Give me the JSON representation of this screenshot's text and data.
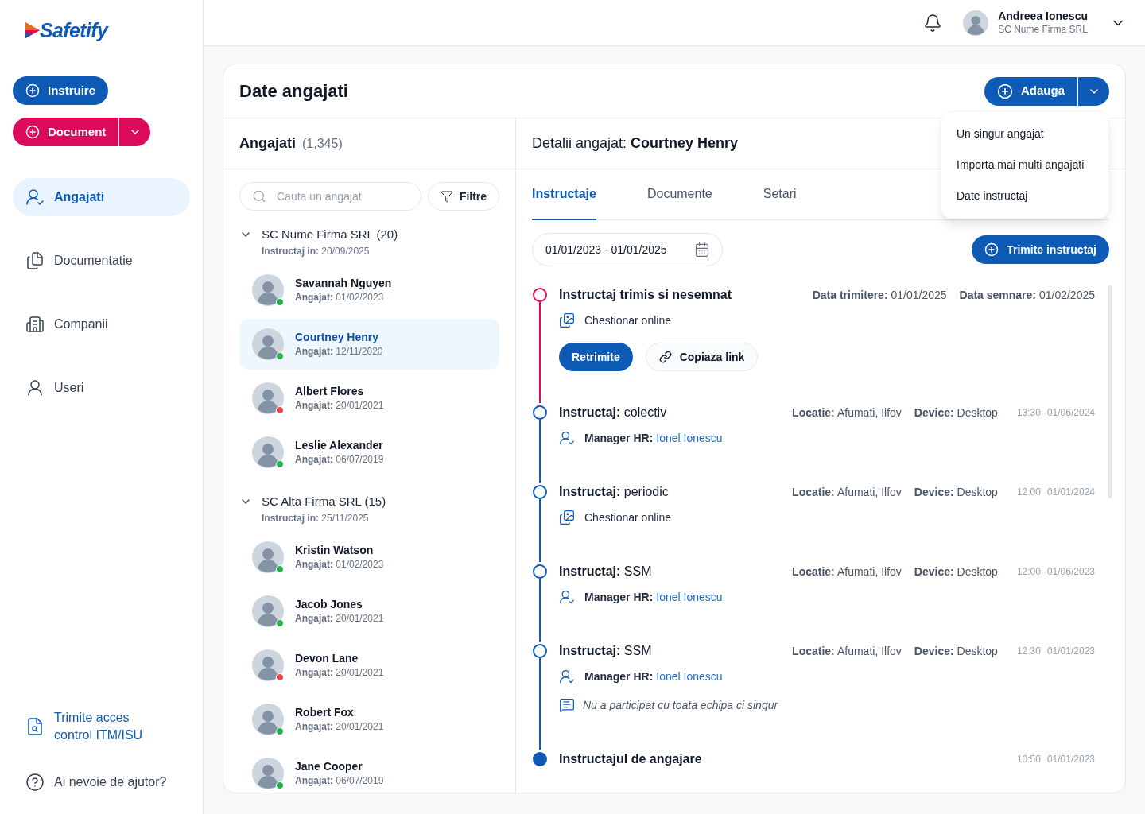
{
  "brand": {
    "name": "Safetify"
  },
  "sidebar": {
    "actions": [
      {
        "label": "Instruire",
        "kind": "primary",
        "has_menu": false
      },
      {
        "label": "Document",
        "kind": "accent",
        "has_menu": true
      }
    ],
    "nav": [
      {
        "label": "Angajati",
        "selected": true
      },
      {
        "label": "Documentatie",
        "selected": false
      },
      {
        "label": "Companii",
        "selected": false
      },
      {
        "label": "Useri",
        "selected": false
      }
    ],
    "footer": [
      {
        "label": "Trimite acces control ITM/ISU",
        "kind": "link"
      },
      {
        "label": "Ai nevoie de ajutor?",
        "kind": "help"
      }
    ]
  },
  "header": {
    "user": {
      "name": "Andreea Ionescu",
      "company": "SC Nume Firma SRL"
    }
  },
  "page": {
    "title": "Date angajati",
    "add_button": {
      "label": "Adauga"
    },
    "add_menu": {
      "open": true,
      "items": [
        "Un singur angajat",
        "Importa mai multi angajati",
        "Date instructaj"
      ]
    }
  },
  "employees": {
    "title": "Angajati",
    "count": "(1,345)",
    "search": {
      "placeholder": "Cauta un angajat"
    },
    "filter_button": "Filtre",
    "groups": [
      {
        "name": "SC Nume Firma SRL (20)",
        "subtitle": "**Instructaj in:** 20/09/2025",
        "expanded": true,
        "employees": [
          {
            "name": "Savannah Nguyen",
            "hired": "**Angajat:** 01/02/2023",
            "selected": false,
            "color": "#22b14c"
          },
          {
            "name": "Courtney Henry",
            "hired": "**Angajat:** 12/11/2020",
            "selected": true,
            "color": "#22b14c"
          },
          {
            "name": "Albert Flores",
            "hired": "**Angajat:** 20/01/2021",
            "selected": false,
            "color": "#e5484d"
          },
          {
            "name": "Leslie Alexander",
            "hired": "**Angajat:** 06/07/2019",
            "selected": false,
            "color": "#22b14c"
          }
        ]
      },
      {
        "name": "SC Alta Firma SRL (15)",
        "subtitle": "**Instructaj in:** 25/11/2025",
        "expanded": true,
        "employees": [
          {
            "name": "Kristin Watson",
            "hired": "**Angajat:** 01/02/2023",
            "selected": false,
            "color": "#22b14c"
          },
          {
            "name": "Jacob Jones",
            "hired": "**Angajat:** 20/01/2021",
            "selected": false,
            "color": "#22b14c"
          },
          {
            "name": "Devon Lane",
            "hired": "**Angajat:** 20/01/2021",
            "selected": false,
            "color": "#e5484d"
          },
          {
            "name": "Robert Fox",
            "hired": "**Angajat:** 20/01/2021",
            "selected": false,
            "color": "#22b14c"
          },
          {
            "name": "Jane Cooper",
            "hired": "**Angajat:** 06/07/2019",
            "selected": false,
            "color": "#22b14c"
          }
        ]
      }
    ]
  },
  "details": {
    "title": "Detalii angajat: **Courtney Henry**",
    "tabs": [
      {
        "label": "Instructaje",
        "selected": true
      },
      {
        "label": "Documente",
        "selected": false
      },
      {
        "label": "Setari",
        "selected": false
      }
    ],
    "date_range": {
      "value": "01/01/2023 - 01/01/2025"
    },
    "send_button": "Trimite instructaj",
    "timeline": [
      {
        "kind": "pending",
        "title": "Instructaj trimis si nesemnat",
        "meta": [
          "**Data trimitere:** 01/01/2025",
          "**Data semnare:** 01/02/2025"
        ],
        "lines": [
          {
            "kind": "questionnaire",
            "text": "Chestionar online"
          }
        ],
        "actions": [
          {
            "label": "Retrimite",
            "kind": "primary"
          },
          {
            "label": "Copiaza link",
            "kind": "link"
          }
        ]
      },
      {
        "kind": "done",
        "title": "**Instructaj:** colectiv",
        "meta": [
          "**Locatie:** Afumati, Ilfov",
          "**Device:** Desktop"
        ],
        "time": "13:30",
        "date": "01/06/2024",
        "lines": [
          {
            "kind": "manager",
            "label": "Manager HR:",
            "link": "Ionel Ionescu"
          }
        ]
      },
      {
        "kind": "done",
        "title": "**Instructaj:** periodic",
        "meta": [
          "**Locatie:** Afumati, Ilfov",
          "**Device:** Desktop"
        ],
        "time": "12:00",
        "date": "01/01/2024",
        "lines": [
          {
            "kind": "questionnaire",
            "text": "Chestionar online"
          }
        ]
      },
      {
        "kind": "done",
        "title": "**Instructaj:** SSM",
        "meta": [
          "**Locatie:** Afumati, Ilfov",
          "**Device:** Desktop"
        ],
        "time": "12:00",
        "date": "01/06/2023",
        "lines": [
          {
            "kind": "manager",
            "label": "Manager HR:",
            "link": "Ionel Ionescu"
          }
        ]
      },
      {
        "kind": "done",
        "title": "**Instructaj:** SSM",
        "meta": [
          "**Locatie:** Afumati, Ilfov",
          "**Device:** Desktop"
        ],
        "time": "12:30",
        "date": "01/01/2023",
        "lines": [
          {
            "kind": "manager",
            "label": "Manager HR:",
            "link": "Ionel Ionescu"
          },
          {
            "kind": "note",
            "text": "Nu a participat cu toata echipa ci singur"
          }
        ]
      },
      {
        "kind": "final",
        "title": "Instructajul de angajare",
        "time": "10:50",
        "date": "01/01/2023"
      }
    ]
  }
}
